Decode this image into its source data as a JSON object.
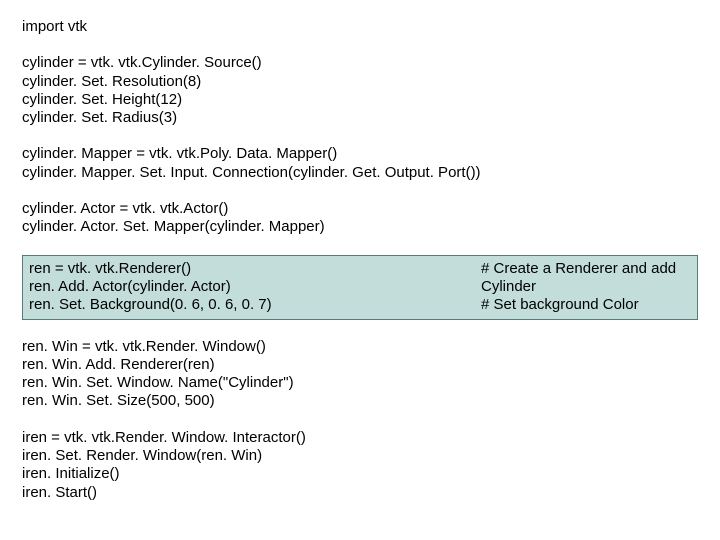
{
  "block1": "import vtk",
  "block2": "cylinder = vtk. vtk.Cylinder. Source()\ncylinder. Set. Resolution(8)\ncylinder. Set. Height(12)\ncylinder. Set. Radius(3)",
  "block3": "cylinder. Mapper = vtk. vtk.Poly. Data. Mapper()\ncylinder. Mapper. Set. Input. Connection(cylinder. Get. Output. Port())",
  "block4": "cylinder. Actor = vtk. vtk.Actor()\ncylinder. Actor. Set. Mapper(cylinder. Mapper)",
  "highlight": {
    "code": "ren = vtk. vtk.Renderer()\nren. Add. Actor(cylinder. Actor)\nren. Set. Background(0. 6, 0. 6, 0. 7)",
    "comment1": "# Create a Renderer and add Cylinder",
    "comment2": "# Set background Color"
  },
  "block6": "ren. Win = vtk. vtk.Render. Window()\nren. Win. Add. Renderer(ren)\nren. Win. Set. Window. Name(\"Cylinder\")\nren. Win. Set. Size(500, 500)",
  "block7": "iren = vtk. vtk.Render. Window. Interactor()\niren. Set. Render. Window(ren. Win)\niren. Initialize()\niren. Start()"
}
